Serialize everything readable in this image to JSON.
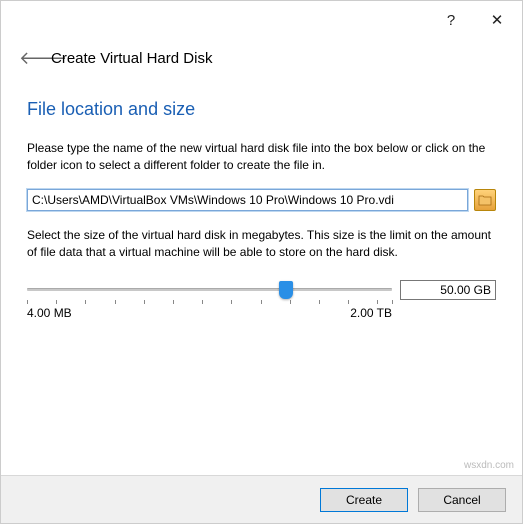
{
  "window": {
    "title": "Create Virtual Hard Disk",
    "help_icon": "?",
    "close_icon": "✕",
    "back_icon": "🡐"
  },
  "section": {
    "heading": "File location and size",
    "path_instruction": "Please type the name of the new virtual hard disk file into the box below or click on the folder icon to select a different folder to create the file in.",
    "size_instruction": "Select the size of the virtual hard disk in megabytes. This size is the limit on the amount of file data that a virtual machine will be able to store on the hard disk."
  },
  "inputs": {
    "file_path": "C:\\Users\\AMD\\VirtualBox VMs\\Windows 10 Pro\\Windows 10 Pro.vdi",
    "size_value": "50.00 GB",
    "size_min_label": "4.00 MB",
    "size_max_label": "2.00 TB"
  },
  "buttons": {
    "create": "Create",
    "cancel": "Cancel"
  },
  "watermark": "wsxdn.com"
}
